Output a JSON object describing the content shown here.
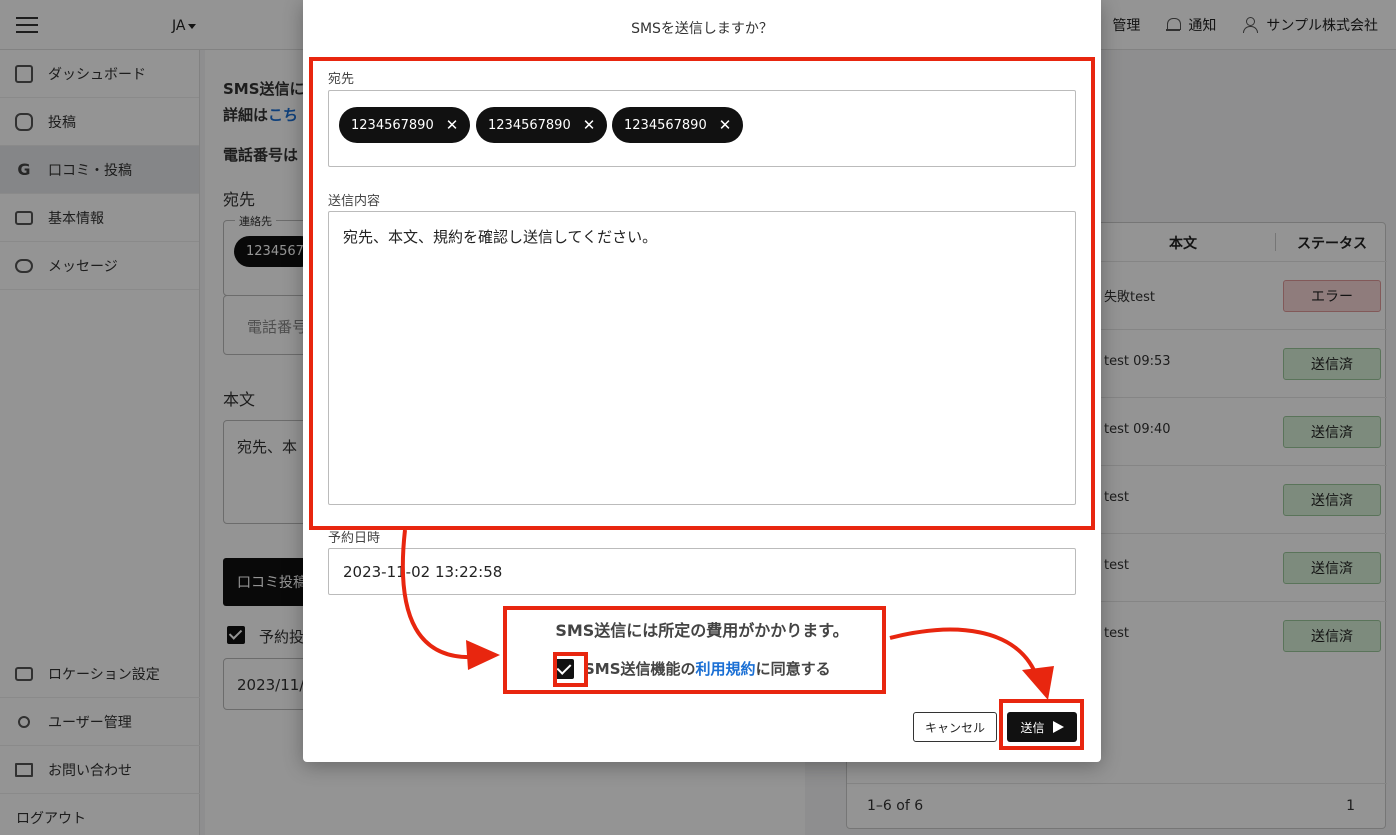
{
  "topbar": {
    "lang": "JA",
    "admin_partial": "管理",
    "notify": "通知",
    "company": "サンプル株式会社"
  },
  "sidebar": {
    "items": [
      {
        "label": "ダッシュボード"
      },
      {
        "label": "投稿"
      },
      {
        "label": "口コミ・投稿"
      },
      {
        "label": "基本情報"
      },
      {
        "label": "メッセージ"
      }
    ],
    "bottom": [
      {
        "label": "ロケーション設定"
      },
      {
        "label": "ユーザー管理"
      },
      {
        "label": "お問い合わせ"
      },
      {
        "label": "ログアウト"
      }
    ],
    "google_glyph": "G"
  },
  "main": {
    "line1": "SMS送信に",
    "line2_prefix": "詳細は",
    "line2_link": "こち",
    "line3": "電話番号は",
    "recipient_label": "宛先",
    "contact_legend": "連絡先",
    "chip_partial": "1234567",
    "phone_placeholder": "電話番号",
    "body_label": "本文",
    "body_partial": "宛先、本",
    "post_btn": "口コミ投稿",
    "schedule_label": "予約投",
    "date_partial": "2023/11/"
  },
  "table": {
    "col_body": "本文",
    "col_status": "ステータス",
    "rows": [
      {
        "body": "失敗test",
        "status": "エラー",
        "type": "err"
      },
      {
        "body": "test 09:53",
        "status": "送信済",
        "type": "ok"
      },
      {
        "body": "test 09:40",
        "status": "送信済",
        "type": "ok"
      },
      {
        "body": "test",
        "status": "送信済",
        "type": "ok"
      },
      {
        "body": "test",
        "status": "送信済",
        "type": "ok"
      },
      {
        "body": "test",
        "status": "送信済",
        "type": "ok"
      }
    ],
    "pagination": "1–6 of 6",
    "page": "1"
  },
  "modal": {
    "title": "SMSを送信しますか？",
    "recipient_label": "宛先",
    "chips": [
      "1234567890",
      "1234567890",
      "1234567890"
    ],
    "chip_remove": "✕",
    "content_label": "送信内容",
    "content_text": "宛先、本文、規約を確認し送信してください。",
    "schedule_label": "予約日時",
    "schedule_value": "2023-11-02 13:22:58",
    "notice": "SMS送信には所定の費用がかかります。",
    "agree_prefix": "SMS送信機能の",
    "agree_link": "利用規約",
    "agree_suffix": "に同意する",
    "cancel": "キャンセル",
    "send": "送信"
  },
  "colors": {
    "annotation_red": "#e8260f",
    "link_blue": "#1a6fd4"
  }
}
